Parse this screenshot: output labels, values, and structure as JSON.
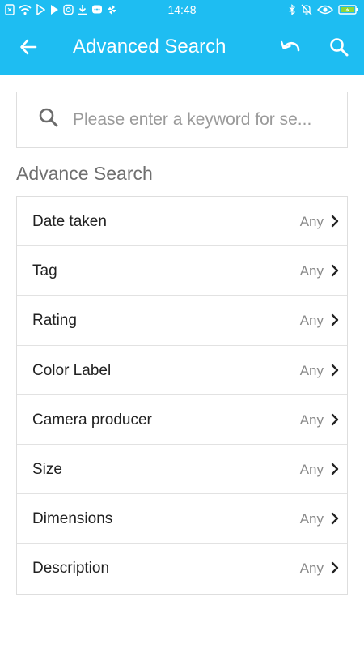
{
  "status_bar": {
    "time": "14:48",
    "left_icons": [
      "sim-icon",
      "wifi-icon",
      "play-store-icon",
      "play-store-icon-2",
      "instagram-icon",
      "download-icon",
      "chat-icon",
      "pinwheel-icon"
    ],
    "right_icons": [
      "bluetooth-icon",
      "mute-bell-icon",
      "eye-icon",
      "battery-icon"
    ]
  },
  "app_bar": {
    "title": "Advanced Search",
    "background": "#1ebdf2"
  },
  "search": {
    "placeholder": "Please enter a keyword for se...",
    "value": ""
  },
  "section": {
    "title": "Advance Search"
  },
  "options": [
    {
      "label": "Date taken",
      "value": "Any"
    },
    {
      "label": "Tag",
      "value": "Any"
    },
    {
      "label": "Rating",
      "value": "Any"
    },
    {
      "label": "Color Label",
      "value": "Any"
    },
    {
      "label": "Camera producer",
      "value": "Any"
    },
    {
      "label": "Size",
      "value": "Any"
    },
    {
      "label": "Dimensions",
      "value": "Any"
    },
    {
      "label": "Description",
      "value": "Any"
    }
  ]
}
